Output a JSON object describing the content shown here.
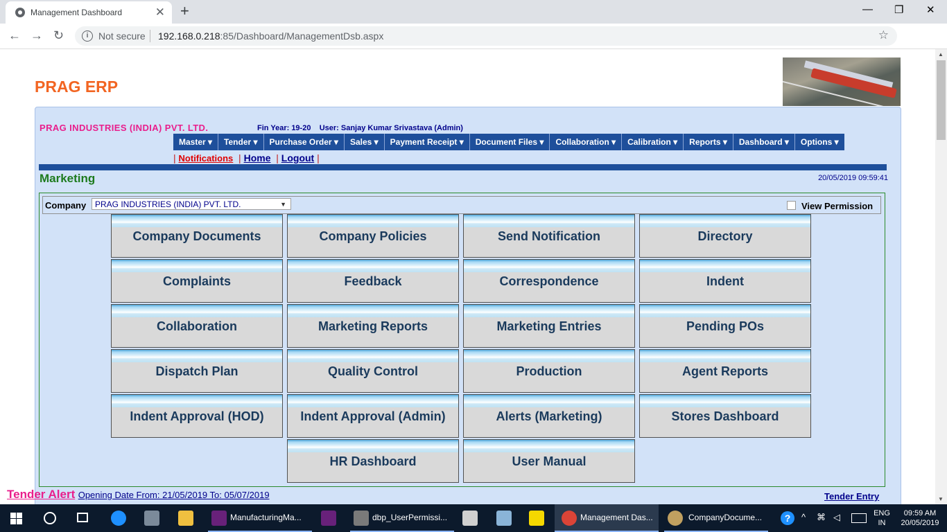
{
  "browser": {
    "tab_title": "Management Dashboard",
    "tab_close": "✕",
    "new_tab": "+",
    "window_buttons": [
      "—",
      "❐",
      "✕"
    ],
    "security": "Not secure",
    "url_host": "192.168.0.218",
    "url_rest": ":85/Dashboard/ManagementDsb.aspx",
    "nav_back": "←",
    "nav_forward": "→",
    "nav_reload": "↻",
    "star": "☆",
    "menu": "⋮"
  },
  "header": {
    "brand": "PRAG ERP",
    "company": "PRAG INDUSTRIES (INDIA) PVT. LTD.",
    "fin_year": "Fin Year: 19-20",
    "user": "User: Sanjay Kumar Srivastava (Admin)"
  },
  "menu": [
    "Master",
    "Tender",
    "Purchase Order",
    "Sales",
    "Payment Receipt",
    "Document Files",
    "Collaboration",
    "Calibration",
    "Reports",
    "Dashboard",
    "Options"
  ],
  "links": {
    "notifications": "Notifications",
    "home": "Home",
    "logout": "Logout"
  },
  "section": {
    "title": "Marketing",
    "datetime": "20/05/2019 09:59:41"
  },
  "filter": {
    "company_label": "Company",
    "company_value": "PRAG INDUSTRIES (INDIA) PVT. LTD.",
    "view_permission": "View Permission"
  },
  "tiles": [
    "Company Documents",
    "Company Policies",
    "Send Notification",
    "Directory",
    "Complaints",
    "Feedback",
    "Correspondence",
    "Indent",
    "Collaboration",
    "Marketing Reports",
    "Marketing Entries",
    "Pending POs",
    "Dispatch Plan",
    "Quality Control",
    "Production",
    "Agent Reports",
    "Indent Approval (HOD)",
    "Indent Approval (Admin)",
    "Alerts (Marketing)",
    "Stores Dashboard",
    "HR Dashboard",
    "User Manual"
  ],
  "tender": {
    "title": "Tender Alert",
    "opening": "Opening Date From: 21/05/2019 To: 05/07/2019",
    "entry": "Tender Entry"
  },
  "taskbar": {
    "apps": [
      {
        "label": "ManufacturingMa...",
        "color": "#68217a"
      },
      {
        "label": "dbp_UserPermissi...",
        "color": "#7a7a7a"
      },
      {
        "label": "Management Das...",
        "color": "#db4437"
      },
      {
        "label": "CompanyDocume...",
        "color": "#c0a060"
      }
    ],
    "lang_1": "ENG",
    "lang_2": "IN",
    "time": "09:59 AM",
    "date": "20/05/2019"
  }
}
